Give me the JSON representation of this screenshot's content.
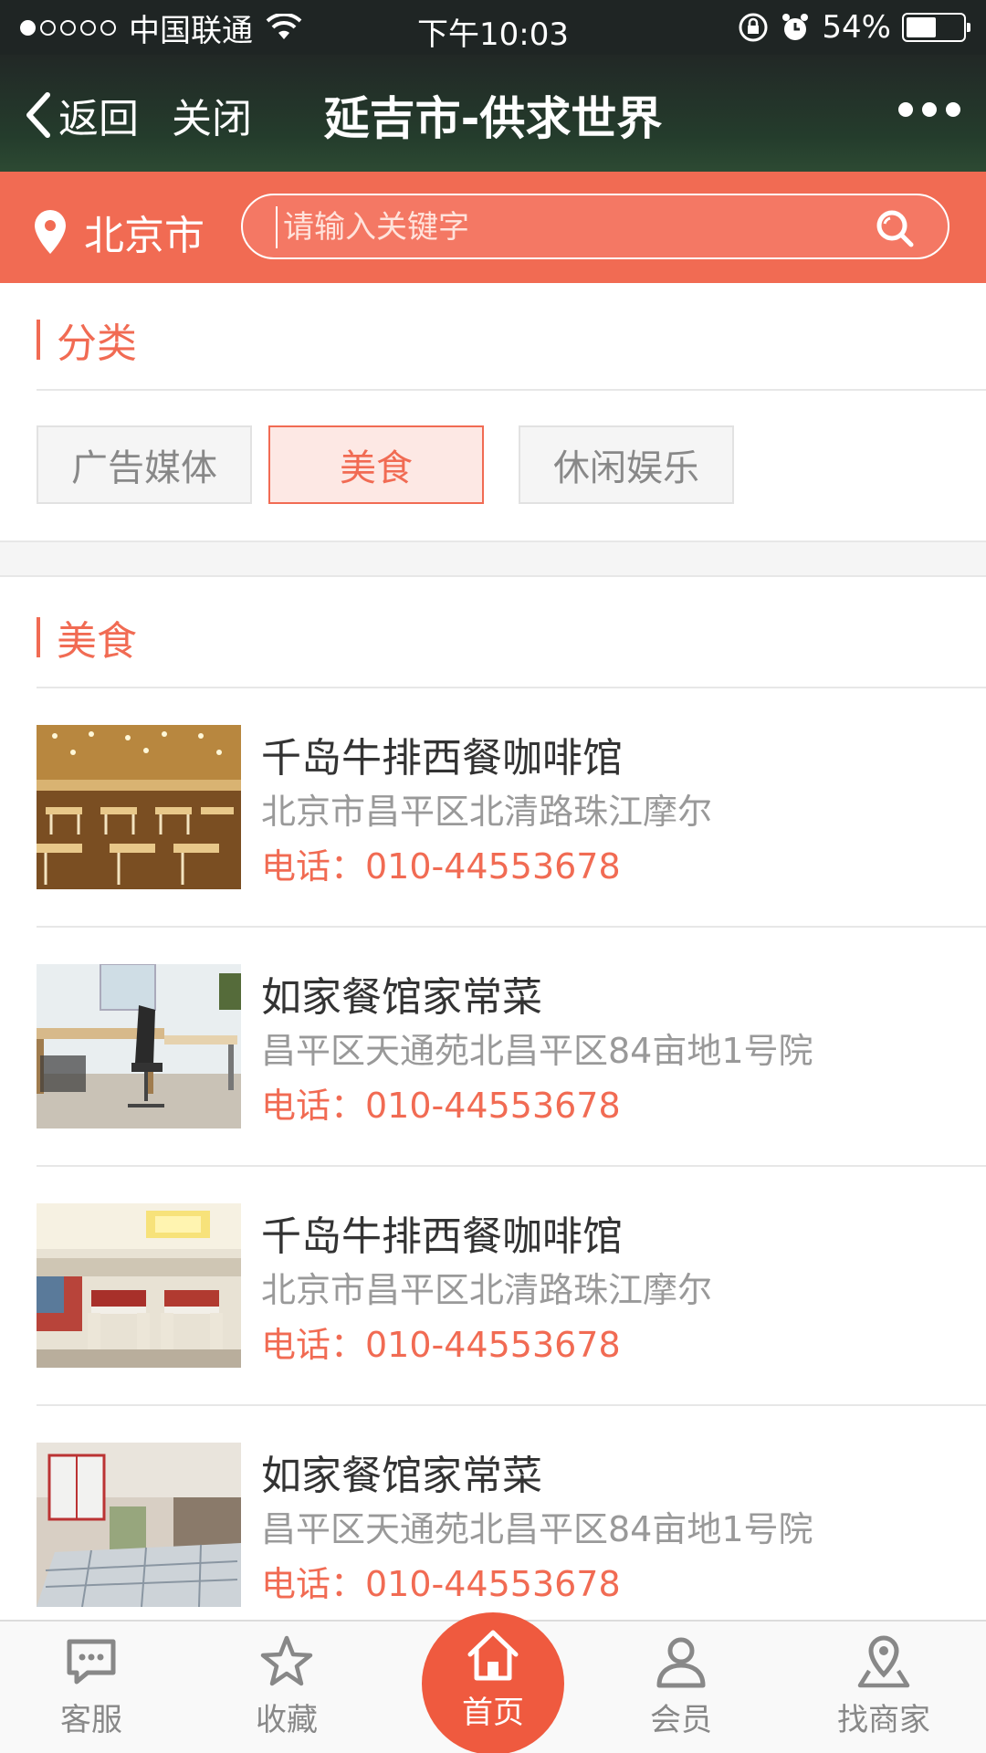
{
  "status_bar": {
    "carrier": "中国联通",
    "time": "下午10:03",
    "battery": "54%",
    "battery_level": 0.54,
    "signal_bars": 1
  },
  "nav": {
    "back_label": "返回",
    "close_label": "关闭",
    "title": "延吉市-供求世界"
  },
  "search": {
    "city": "北京市",
    "placeholder": "请输入关键字"
  },
  "category": {
    "title": "分类",
    "chips": [
      {
        "label": "广告媒体",
        "active": false
      },
      {
        "label": "美食",
        "active": true
      },
      {
        "label": "休闲娱乐",
        "active": false
      }
    ]
  },
  "listing": {
    "title": "美食",
    "items": [
      {
        "name": "千岛牛排西餐咖啡馆",
        "address": "北京市昌平区北清路珠江摩尔",
        "phone": "电话：010-44553678",
        "image": "restaurant-hall-image"
      },
      {
        "name": "如家餐馆家常菜",
        "address": "昌平区天通苑北昌平区84亩地1号院",
        "phone": "电话：010-44553678",
        "image": "room-desk-image"
      },
      {
        "name": "千岛牛排西餐咖啡馆",
        "address": "北京市昌平区北清路珠江摩尔",
        "phone": "电话：010-44553678",
        "image": "dining-room-image"
      },
      {
        "name": "如家餐馆家常菜",
        "address": "昌平区天通苑北昌平区84亩地1号院",
        "phone": "电话：010-44553678",
        "image": "bedroom-image"
      }
    ]
  },
  "tabbar": {
    "tabs": [
      {
        "label": "客服",
        "icon": "chat-icon"
      },
      {
        "label": "收藏",
        "icon": "star-icon"
      },
      {
        "label": "首页",
        "icon": "home-icon"
      },
      {
        "label": "会员",
        "icon": "user-icon"
      },
      {
        "label": "找商家",
        "icon": "map-pin-icon"
      }
    ]
  },
  "colors": {
    "accent": "#f16b53",
    "home_button": "#ef5a3f",
    "nav_bg": "#243c2c"
  }
}
